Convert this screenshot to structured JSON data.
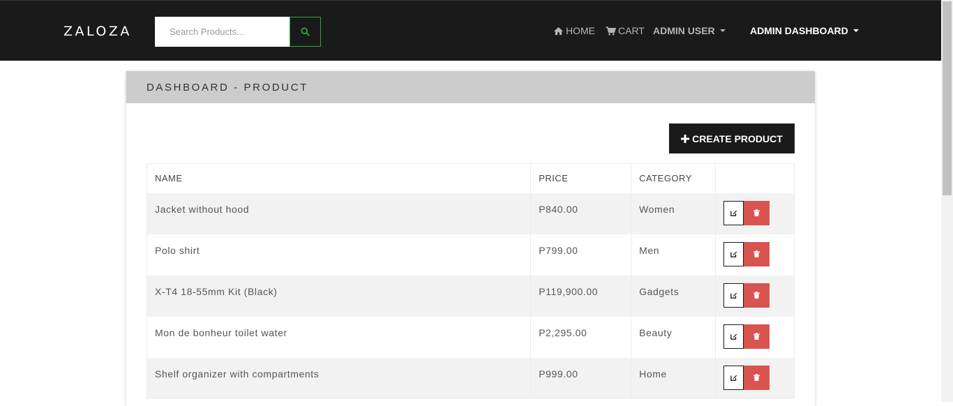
{
  "navbar": {
    "brand": "ZALOZA",
    "search_placeholder": "Search Products...",
    "links": [
      {
        "label": "HOME",
        "icon": "home-icon"
      },
      {
        "label": "CART",
        "icon": "cart-icon"
      },
      {
        "label": "ADMIN USER",
        "icon": "chevron-down-icon"
      },
      {
        "label": "ADMIN DASHBOARD",
        "icon": "chevron-down-icon"
      }
    ]
  },
  "panel": {
    "title": "DASHBOARD - PRODUCT",
    "create_label": "CREATE PRODUCT"
  },
  "table": {
    "headers": [
      "NAME",
      "PRICE",
      "CATEGORY",
      ""
    ],
    "rows": [
      {
        "name": "Jacket without hood",
        "price": "P840.00",
        "category": "Women"
      },
      {
        "name": "Polo shirt",
        "price": "P799.00",
        "category": "Men"
      },
      {
        "name": "X-T4 18-55mm Kit (Black)",
        "price": "P119,900.00",
        "category": "Gadgets"
      },
      {
        "name": "Mon de bonheur toilet water",
        "price": "P2,295.00",
        "category": "Beauty"
      },
      {
        "name": "Shelf organizer with compartments",
        "price": "P999.00",
        "category": "Home"
      }
    ]
  },
  "colors": {
    "navbar_bg": "#1a1a1a",
    "search_accent": "#28a745",
    "delete_red": "#d9534f",
    "header_gray": "#cccccc"
  }
}
